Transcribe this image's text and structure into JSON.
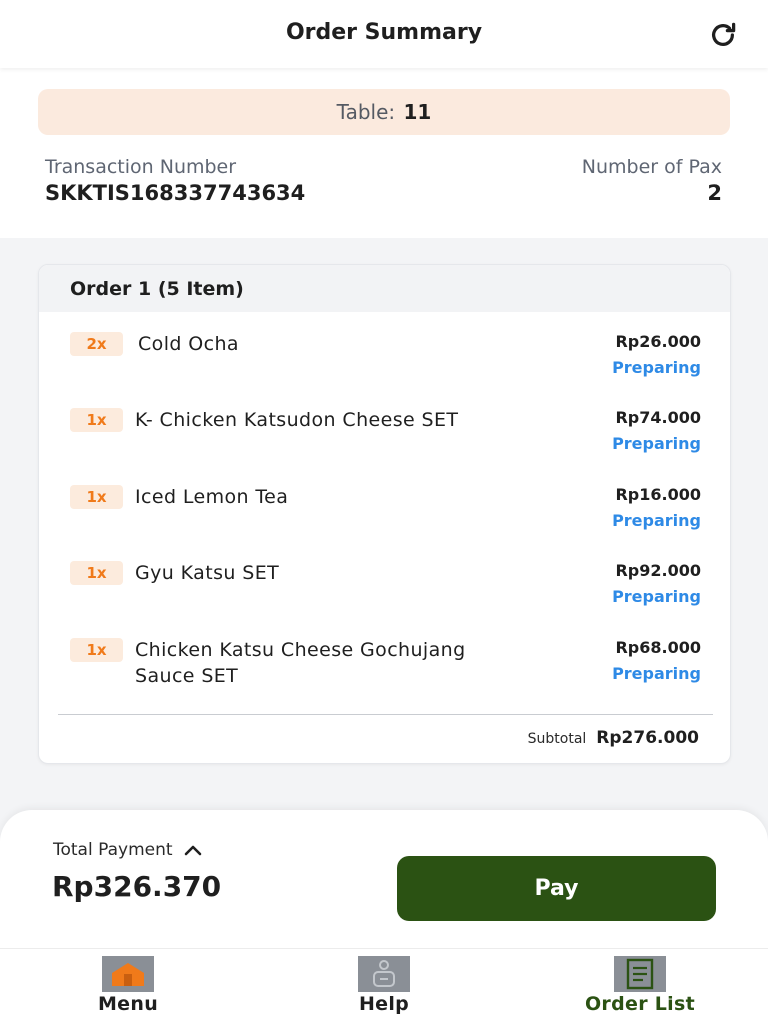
{
  "header": {
    "title": "Order Summary"
  },
  "table": {
    "label": "Table:",
    "number": "11"
  },
  "transaction": {
    "label": "Transaction Number",
    "value": "SKKTIS168337743634"
  },
  "pax": {
    "label": "Number of Pax",
    "value": "2"
  },
  "order": {
    "title": "Order 1 (5 Item)",
    "items": [
      {
        "qty": "2x",
        "name": "Cold Ocha",
        "price": "Rp26.000",
        "status": "Preparing"
      },
      {
        "qty": "1x",
        "name": "K- Chicken Katsudon Cheese SET",
        "price": "Rp74.000",
        "status": "Preparing"
      },
      {
        "qty": "1x",
        "name": "Iced Lemon Tea",
        "price": "Rp16.000",
        "status": "Preparing"
      },
      {
        "qty": "1x",
        "name": "Gyu Katsu SET",
        "price": "Rp92.000",
        "status": "Preparing"
      },
      {
        "qty": "1x",
        "name": "Chicken Katsu Cheese Gochujang Sauce SET",
        "price": "Rp68.000",
        "status": "Preparing"
      }
    ],
    "subtotal_label": "Subtotal",
    "subtotal_value": "Rp276.000"
  },
  "payment": {
    "total_label": "Total Payment",
    "total_value": "Rp326.370",
    "pay_label": "Pay"
  },
  "nav": {
    "items": [
      {
        "label": "Menu",
        "icon": "menu-house-icon"
      },
      {
        "label": "Help",
        "icon": "help-waiter-icon"
      },
      {
        "label": "Order List",
        "icon": "order-list-icon"
      }
    ]
  },
  "colors": {
    "accent_orange": "#f07a1a",
    "status_blue": "#2e8ae6",
    "pay_green": "#2b5213",
    "banner_peach": "#fbeade"
  }
}
